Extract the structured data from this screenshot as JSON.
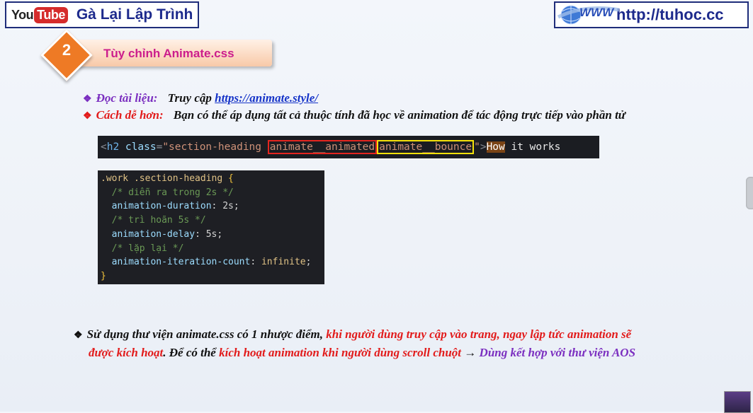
{
  "brand": {
    "youtube_you": "You",
    "youtube_tube": "Tube",
    "channel_name": "Gà Lại Lập Trình"
  },
  "website": {
    "icon_text": "WWW",
    "url": "http://tuhoc.cc"
  },
  "step": {
    "number": "2",
    "title": "Tùy chỉnh Animate.css"
  },
  "bullets": [
    {
      "label": "Đọc tài liệu:",
      "text": "Truy cập",
      "link": "https://animate.style/"
    },
    {
      "label": "Cách dễ hơn:",
      "text": "Bạn có thể áp dụng tất cả thuộc tính đã học về animation để tác động trực tiếp vào phần tử"
    }
  ],
  "code_line": {
    "open": "<",
    "tag": "h2",
    "attr": " class",
    "eq": "=",
    "str_start": "\"section-heading ",
    "class1": "animate__animated",
    "class2": "animate__bounce",
    "str_end": "\"",
    "close": ">",
    "text_hl": "How",
    "text_rest": " it works"
  },
  "css_block": {
    "selector": ".work .section-heading ",
    "open_brace": "{",
    "comment1": "/* diễn ra trong 2s */",
    "prop1": "animation-duration",
    "val1": "2s",
    "comment2": "/* trì hoãn 5s */",
    "prop2": "animation-delay",
    "val2": "5s",
    "comment3": "/* lặp lại */",
    "prop3": "animation-iteration-count",
    "val3": "infinite",
    "close_brace": "}"
  },
  "note": {
    "part1": "Sử dụng thư viện animate.css có 1 nhược điểm, ",
    "part2": "khi người dùng truy cập vào trang, ngay lập tức animation sẽ",
    "part3": "được kích hoạt",
    "part4": ". Để có thể ",
    "part5": "kích hoạt animation khi người dùng scroll chuột",
    "arrow": " → ",
    "part6": "Dùng kết hợp với thư viện AOS"
  },
  "colors": {
    "accent_orange": "#ee7a25",
    "title_magenta": "#cc1d8c",
    "purple": "#7b2fc0",
    "red": "#e21b1b",
    "navy": "#1d2a8c"
  }
}
